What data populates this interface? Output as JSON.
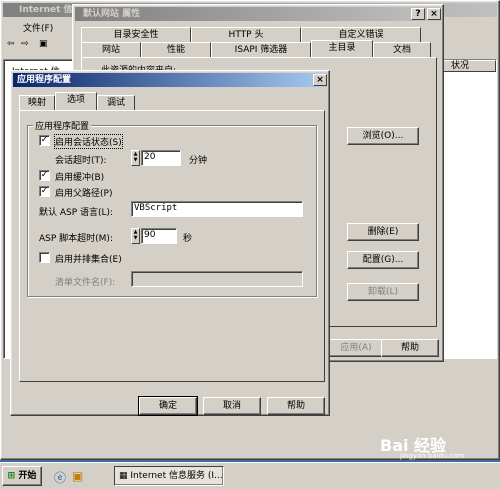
{
  "bg_window": {
    "title": "Internet 信",
    "menu_file": "文件(F)",
    "tree_item": "Internet 信",
    "status_col": "状况"
  },
  "props_dialog": {
    "title": "默认网站 属性",
    "tabs_row1": [
      "目录安全性",
      "HTTP 头",
      "自定义错误"
    ],
    "tabs_row2": [
      "网站",
      "性能",
      "ISAPI 筛选器",
      "主目录",
      "文档"
    ],
    "content_label": "此资源的内容来自:",
    "browse_btn": "浏览(O)...",
    "delete_btn": "删除(E)",
    "config_btn": "配置(G)...",
    "unload_btn": "卸载(L)",
    "apply_btn": "应用(A)",
    "help_btn": "帮助"
  },
  "app_config": {
    "title": "应用程序配置",
    "tabs": [
      "映射",
      "选项",
      "调试"
    ],
    "group_label": "应用程序配置",
    "session_state": "启用会话状态(S)",
    "session_timeout_label": "会话超时(T):",
    "session_timeout_value": "20",
    "session_timeout_unit": "分钟",
    "buffering": "启用缓冲(B)",
    "parent_paths": "启用父路径(P)",
    "asp_language_label": "默认 ASP 语言(L):",
    "asp_language_value": "VBScript",
    "asp_timeout_label": "ASP 脚本超时(M):",
    "asp_timeout_value": "90",
    "asp_timeout_unit": "秒",
    "side_by_side": "启用并排集合(E)",
    "manifest_label": "清单文件名(F):",
    "ok_btn": "确定",
    "cancel_btn": "取消",
    "help_btn": "帮助",
    "close_glyph": "×",
    "help_glyph": "?"
  },
  "taskbar": {
    "start": "开始",
    "task": "Internet 信息服务 (I...",
    "watermark": "Bai 经验",
    "watermark_url": "jingyan.baidu.com"
  },
  "colors": {
    "desktop": "#3a6ea5",
    "active_title": "#0a246a",
    "face": "#d4d0c8"
  }
}
